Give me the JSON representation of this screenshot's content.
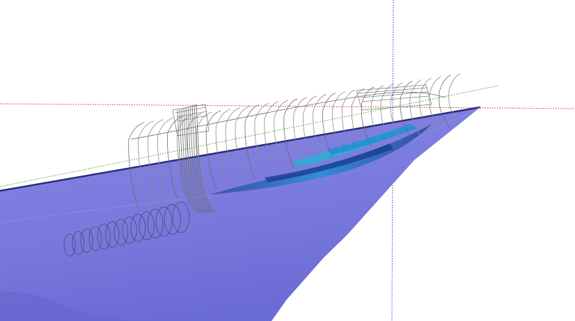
{
  "viewport": {
    "background": "#ffffff"
  },
  "axes": {
    "red_axis_color": "#d62020",
    "green_axis_color": "#2aa82a",
    "blue_axis_color": "#2a2ad6"
  },
  "surface": {
    "fill_top": "#7f7fe0",
    "fill_bottom": "#6f6fd8",
    "edge_color": "#3a3a9a"
  },
  "hull": {
    "line_color": "#8a8a8a",
    "dark_line_color": "#4a4a6a",
    "accent_blue": "#1e90d8",
    "accent_cyan": "#22b4d4",
    "accent_navy": "#1a3a8a"
  }
}
